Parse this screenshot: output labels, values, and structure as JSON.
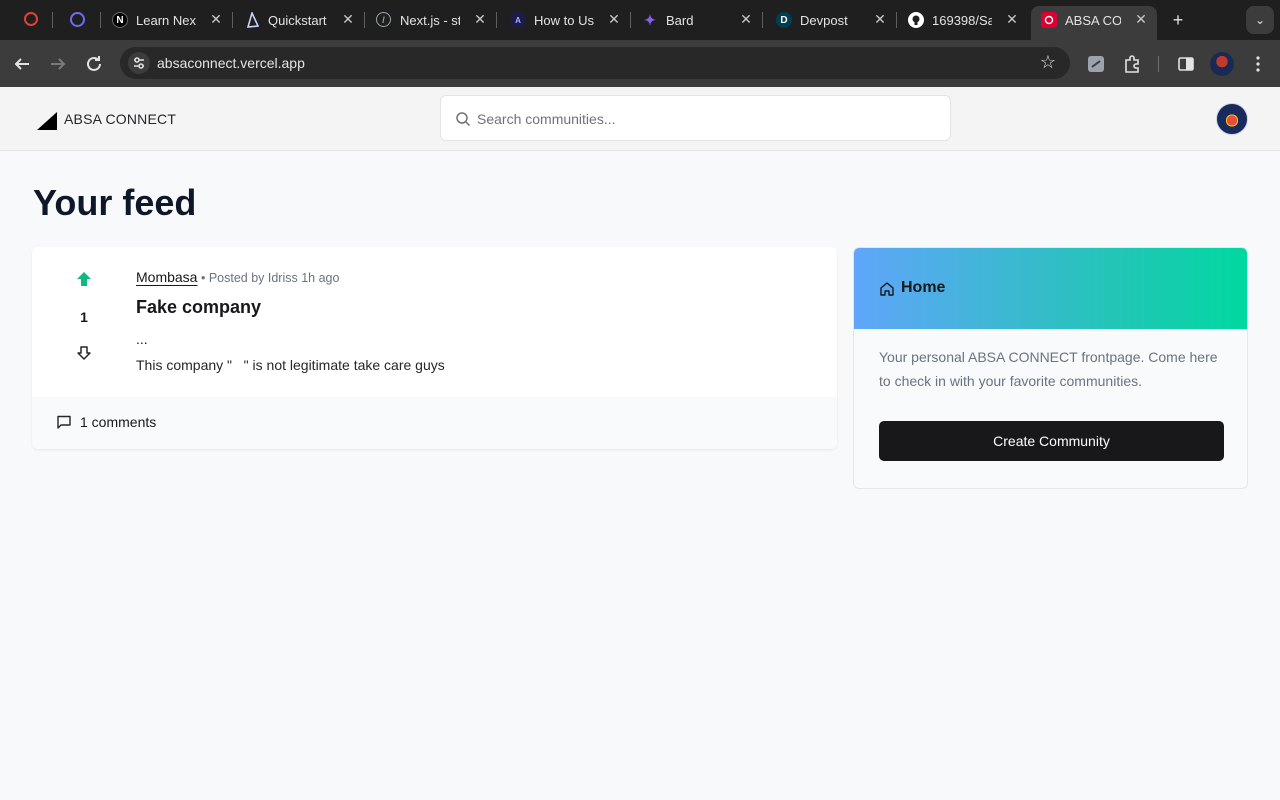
{
  "browser": {
    "tabs": [
      {
        "title": "",
        "icon": "opera-icon",
        "color": "#e0403a"
      },
      {
        "title": "",
        "icon": "c-logo-icon",
        "color": "#6f6cf2"
      },
      {
        "title": "Learn Next",
        "icon": "nextjs-icon",
        "color": "#000000"
      },
      {
        "title": "Quickstart",
        "icon": "prisma-icon",
        "color": "#c7d2fe"
      },
      {
        "title": "Next.js - st",
        "icon": "compass-icon",
        "color": "#9ca3af"
      },
      {
        "title": "How to Use",
        "icon": "a-logo-icon",
        "color": "#6366f1"
      },
      {
        "title": "Bard",
        "icon": "sparkle-icon",
        "color": "#8b5cf6"
      },
      {
        "title": "Devpost",
        "icon": "devpost-icon",
        "color": "#003e54"
      },
      {
        "title": "169398/Sa",
        "icon": "github-icon",
        "color": "#ffffff"
      },
      {
        "title": "ABSA CON",
        "icon": "absa-icon",
        "color": "#dc0032"
      }
    ],
    "url": "absaconnect.vercel.app"
  },
  "header": {
    "brand": "ABSA CONNECT",
    "search_placeholder": "Search communities..."
  },
  "main": {
    "title": "Your feed"
  },
  "post": {
    "votes": "1",
    "subreddit": "Mombasa",
    "meta": "Posted by Idriss 1h ago",
    "title": "Fake company",
    "ellipsis": "...",
    "body": "This company \"   \" is not legitimate take care guys",
    "comments": "1 comments"
  },
  "sidebar": {
    "title": "Home",
    "description": "Your personal ABSA CONNECT frontpage. Come here to check in with your favorite communities.",
    "button": "Create Community"
  },
  "colors": {
    "upvote_active": "#10b981",
    "gradient_start": "#60a5fa",
    "gradient_end": "#00d8a0",
    "button_bg": "#18181b"
  }
}
